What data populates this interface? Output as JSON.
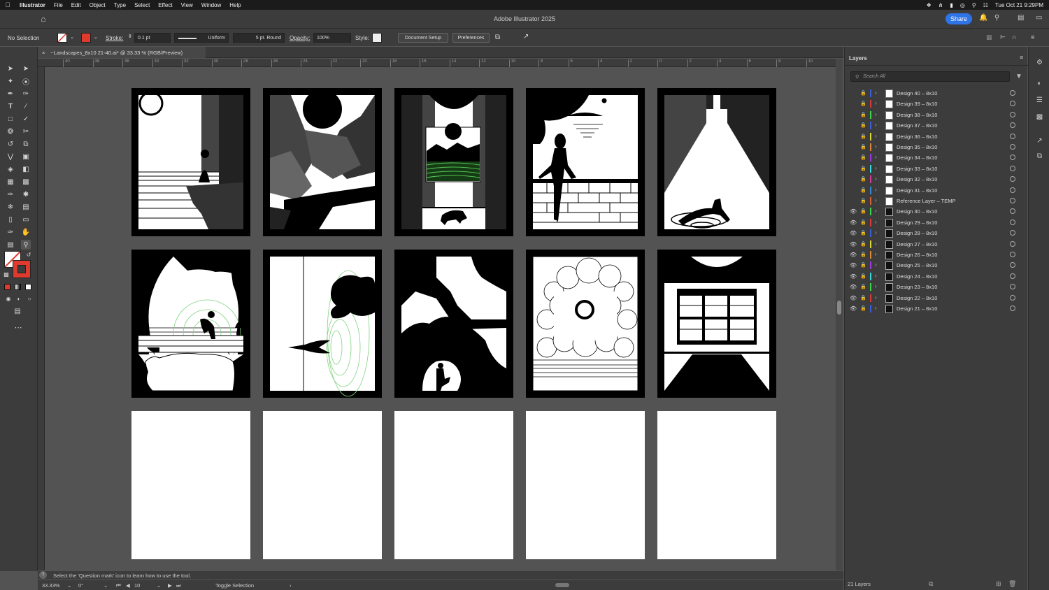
{
  "menubar": {
    "app": "Illustrator",
    "items": [
      "File",
      "Edit",
      "Object",
      "Type",
      "Select",
      "Effect",
      "View",
      "Window",
      "Help"
    ],
    "datetime": "Tue Oct 21  9:29PM"
  },
  "titlebar": {
    "title": "Adobe Illustrator 2025",
    "share_label": "Share"
  },
  "control": {
    "selection": "No Selection",
    "stroke_label": "Stroke:",
    "stroke_value": "0.1 pt",
    "profile": "Uniform",
    "brush": "5 pt. Round",
    "opacity_label": "Opacity:",
    "opacity_value": "100%",
    "style_label": "Style:",
    "doc_setup": "Document Setup",
    "preferences": "Preferences"
  },
  "document_tab": {
    "title": "~Landscapes_8x10 21-40.ai* @ 33.33 % (RGB/Preview)",
    "close": "×"
  },
  "ruler": {
    "marks": [
      "40",
      "38",
      "36",
      "34",
      "32",
      "30",
      "28",
      "26",
      "24",
      "22",
      "20",
      "18",
      "16",
      "14",
      "12",
      "10",
      "8",
      "6",
      "4",
      "2",
      "0",
      "2",
      "4",
      "6",
      "8",
      "10",
      "12",
      "14",
      "16"
    ]
  },
  "status": {
    "hint": "Select the 'Question mark' icon to learn how to use the tool."
  },
  "bottombar": {
    "zoom": "33.33%",
    "rotation": "0°",
    "artboard": "10",
    "tool": "Toggle Selection"
  },
  "layers": {
    "title": "Layers",
    "search_placeholder": "Search All",
    "count": "21 Layers",
    "items": [
      {
        "name": "Design 40 – 8x10",
        "visible": false,
        "color": "#3b5fd9",
        "thumb": "light"
      },
      {
        "name": "Design 39 – 8x10",
        "visible": false,
        "color": "#d93b3b",
        "thumb": "light"
      },
      {
        "name": "Design 38 – 8x10",
        "visible": false,
        "color": "#3bd94a",
        "thumb": "light"
      },
      {
        "name": "Design 37 – 8x10",
        "visible": false,
        "color": "#3b5fd9",
        "thumb": "light"
      },
      {
        "name": "Design 36 – 8x10",
        "visible": false,
        "color": "#d9d93b",
        "thumb": "light"
      },
      {
        "name": "Design 35 – 8x10",
        "visible": false,
        "color": "#d98a3b",
        "thumb": "light"
      },
      {
        "name": "Design 34 – 8x10",
        "visible": false,
        "color": "#9b3bd9",
        "thumb": "light"
      },
      {
        "name": "Design 33 – 8x10",
        "visible": false,
        "color": "#3bd9d9",
        "thumb": "light"
      },
      {
        "name": "Design 32 – 8x10",
        "visible": false,
        "color": "#d93b9b",
        "thumb": "light"
      },
      {
        "name": "Design 31 – 8x10",
        "visible": false,
        "color": "#3b8ad9",
        "thumb": "light"
      },
      {
        "name": "Reference Layer – TEMP",
        "visible": false,
        "color": "#d95f3b",
        "thumb": "light"
      },
      {
        "name": "Design 30 – 8x10",
        "visible": true,
        "color": "#3bd94a",
        "thumb": "dark"
      },
      {
        "name": "Design 29 – 8x10",
        "visible": true,
        "color": "#d93b3b",
        "thumb": "dark"
      },
      {
        "name": "Design 28 – 8x10",
        "visible": true,
        "color": "#3b5fd9",
        "thumb": "dark"
      },
      {
        "name": "Design 27 – 8x10",
        "visible": true,
        "color": "#d9d93b",
        "thumb": "dark"
      },
      {
        "name": "Design 26 – 8x10",
        "visible": true,
        "color": "#d98a3b",
        "thumb": "dark"
      },
      {
        "name": "Design 25 – 8x10",
        "visible": true,
        "color": "#9b3bd9",
        "thumb": "dark"
      },
      {
        "name": "Design 24 – 8x10",
        "visible": true,
        "color": "#3bd9d9",
        "thumb": "dark"
      },
      {
        "name": "Design 23 – 8x10",
        "visible": true,
        "color": "#3bd94a",
        "thumb": "dark"
      },
      {
        "name": "Design 22 – 8x10",
        "visible": true,
        "color": "#d93b3b",
        "thumb": "dark"
      },
      {
        "name": "Design 21 – 8x10",
        "visible": true,
        "color": "#3b5fd9",
        "thumb": "dark"
      }
    ]
  },
  "colors": {
    "accent": "#2f74e6",
    "stroke_swatch": "#e03a2f"
  }
}
